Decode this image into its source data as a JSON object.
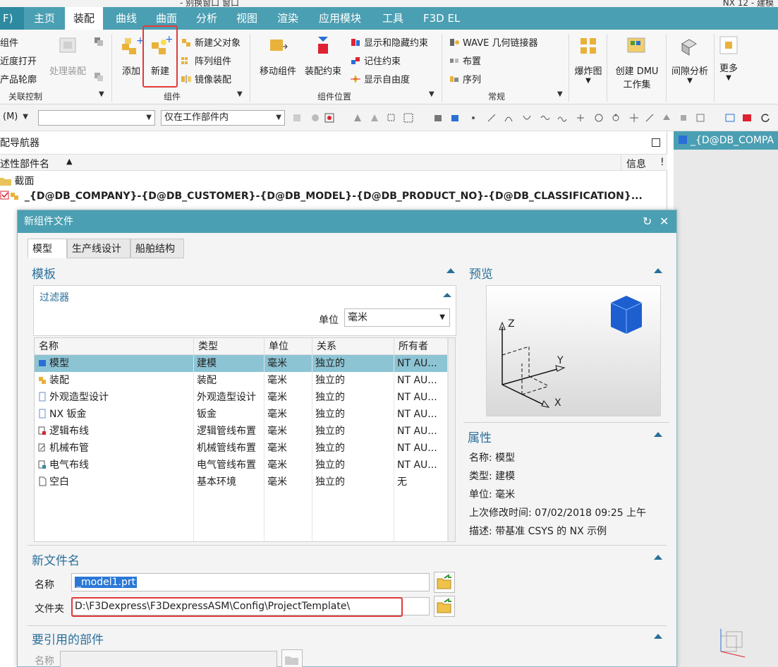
{
  "titlebar": {
    "app": "NX 12 - 建模",
    "partial_menu": "- 别换窗口 窗口"
  },
  "ribbon_tabs": [
    "主页",
    "装配",
    "曲线",
    "曲面",
    "分析",
    "视图",
    "渲染",
    "应用模块",
    "工具",
    "F3D EL"
  ],
  "file_tab": "F)",
  "ribbon": {
    "left_items": [
      "组件",
      "近度打开",
      "产品轮廓"
    ],
    "process_assembly": "处理装配",
    "group_related": "关联控制",
    "add": "添加",
    "new": "新建",
    "new_parent": "新建父对象",
    "array_component": "阵列组件",
    "mirror_assembly": "镜像装配",
    "group_component": "组件",
    "move_component": "移动组件",
    "assembly_constraint": "装配约束",
    "show_hide_constraint": "显示和隐藏约束",
    "remember_constraint": "记住约束",
    "show_dof": "显示自由度",
    "group_position": "组件位置",
    "wave_linker": "WAVE 几何链接器",
    "arrangement": "布置",
    "sequence": "序列",
    "group_general": "常规",
    "exploded_view": "爆炸图",
    "create_dmu": "创建 DMU",
    "workset": "工作集",
    "clearance_analysis": "间隙分析",
    "more": "更多"
  },
  "selbar": {
    "menu": "(M)",
    "scope": "仅在工作部件内"
  },
  "navigator": {
    "title": "配导航器",
    "col_name": "述性部件名",
    "col_info": "信息",
    "col_extra": "!",
    "rows": [
      "截面",
      "_{D@DB_COMPANY}-{D@DB_CUSTOMER}-{D@DB_MODEL}-{D@DB_PRODUCT_NO}-{D@DB_CLASSIFICATION}..."
    ]
  },
  "graphics_tab": "_{D@DB_COMPA",
  "dialog": {
    "title": "新组件文件",
    "tabs": [
      "模型",
      "生产线设计",
      "船舶结构"
    ],
    "template_section": "模板",
    "filter_section": "过滤器",
    "unit_label": "单位",
    "unit_value": "毫米",
    "columns": [
      "名称",
      "类型",
      "单位",
      "关系",
      "所有者"
    ],
    "rows": [
      [
        "模型",
        "建模",
        "毫米",
        "独立的",
        "NT AU..."
      ],
      [
        "装配",
        "装配",
        "毫米",
        "独立的",
        "NT AU..."
      ],
      [
        "外观造型设计",
        "外观造型设计",
        "毫米",
        "独立的",
        "NT AU..."
      ],
      [
        "NX 钣金",
        "钣金",
        "毫米",
        "独立的",
        "NT AU..."
      ],
      [
        "逻辑布线",
        "逻辑管线布置",
        "毫米",
        "独立的",
        "NT AU..."
      ],
      [
        "机械布管",
        "机械管线布置",
        "毫米",
        "独立的",
        "NT AU..."
      ],
      [
        "电气布线",
        "电气管线布置",
        "毫米",
        "独立的",
        "NT AU..."
      ],
      [
        "空白",
        "基本环境",
        "毫米",
        "独立的",
        "无"
      ]
    ],
    "preview_section": "预览",
    "axis_z": "Z",
    "axis_y": "Y",
    "axis_x": "X",
    "properties_section": "属性",
    "properties": [
      [
        "名称:",
        "模型"
      ],
      [
        "类型:",
        "建模"
      ],
      [
        "单位:",
        "毫米"
      ],
      [
        "上次修改时间:",
        "07/02/2018 09:25 上午"
      ],
      [
        "描述:",
        "带基准 CSYS 的 NX 示例"
      ]
    ],
    "new_file_section": "新文件名",
    "name_label": "名称",
    "name_value": "_model1.prt",
    "folder_label": "文件夹",
    "folder_value": "D:\\F3Dexpress\\F3DexpressASM\\Config\\ProjectTemplate\\",
    "ref_section": "要引用的部件",
    "ref_name_label": "名称"
  },
  "colors": {
    "accent": "#4b9fb2",
    "highlight_red": "#e23a3a",
    "selected_row": "#8cc4d4",
    "section_title": "#2a6f9a"
  }
}
